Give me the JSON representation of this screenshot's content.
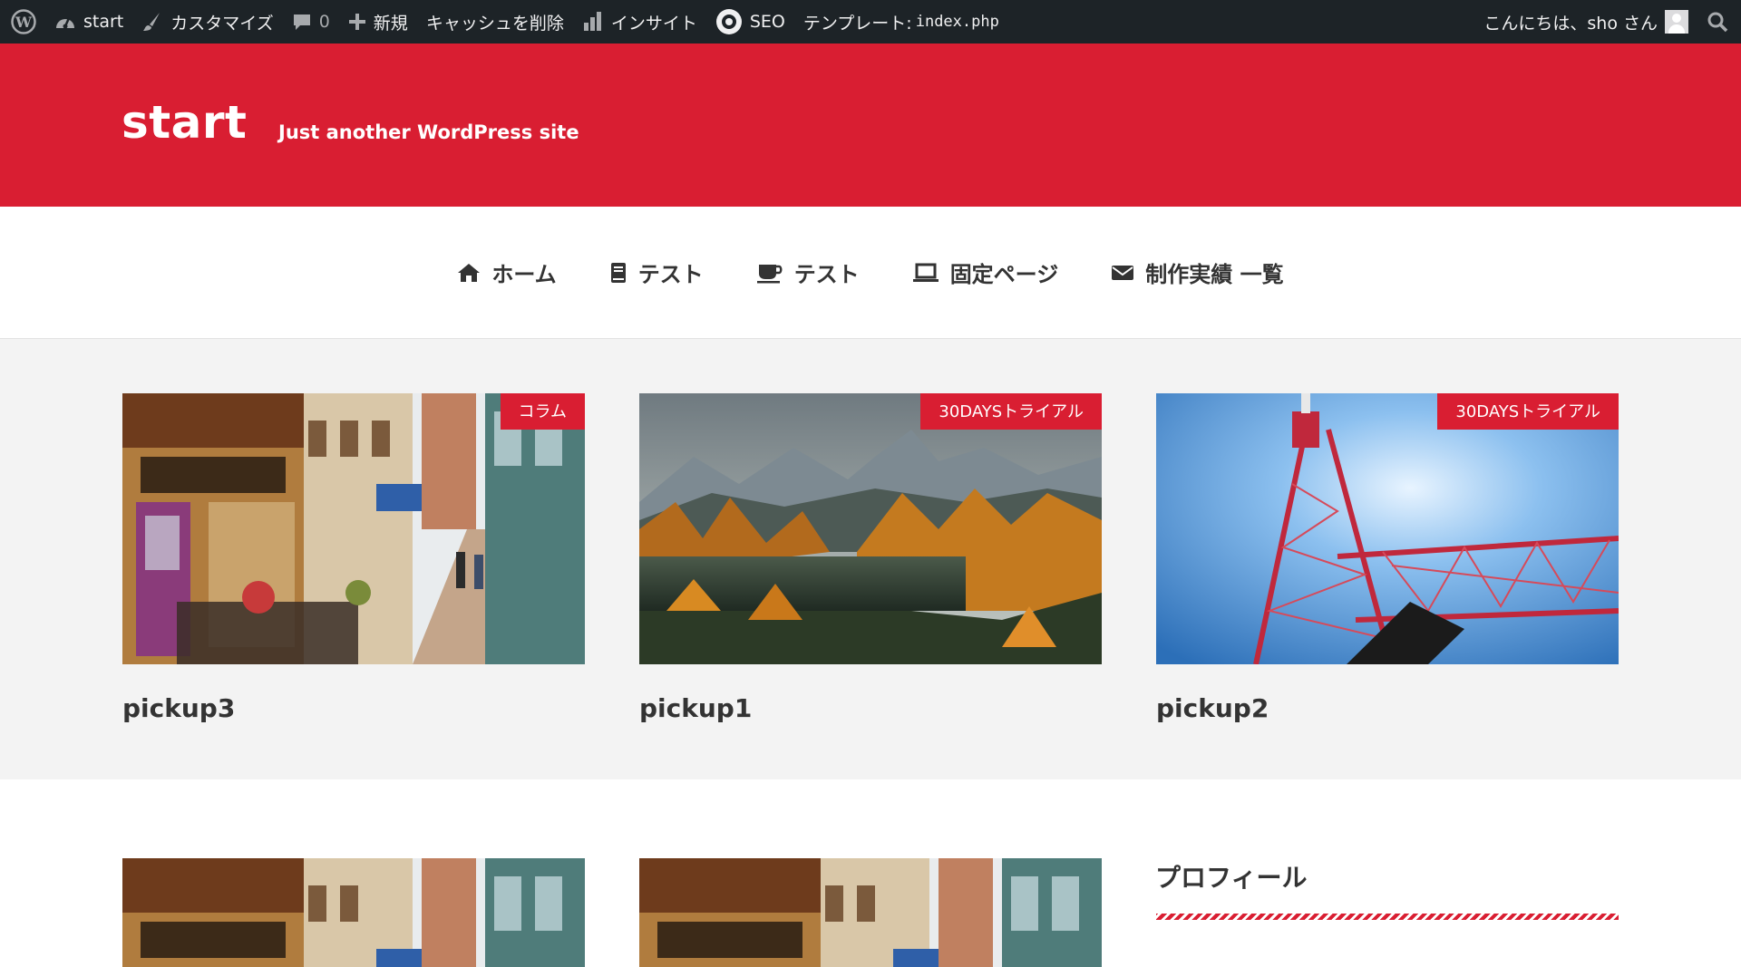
{
  "admin_bar": {
    "site": "start",
    "customize": "カスタマイズ",
    "comments_count": "0",
    "new": "新規",
    "clear_cache": "キャッシュを削除",
    "insights": "インサイト",
    "seo": "SEO",
    "template_label": "テンプレート:",
    "template_file": "index.php",
    "greeting": "こんにちは、sho さん"
  },
  "header": {
    "title": "start",
    "description": "Just another WordPress site",
    "color": "#d91e32"
  },
  "nav": [
    {
      "label": "ホーム",
      "icon": "home-icon"
    },
    {
      "label": "テスト",
      "icon": "book-icon"
    },
    {
      "label": "テスト",
      "icon": "coffee-icon"
    },
    {
      "label": "固定ページ",
      "icon": "laptop-icon"
    },
    {
      "label": "制作実績 一覧",
      "icon": "envelope-icon"
    }
  ],
  "pickup": [
    {
      "title": "pickup3",
      "category": "コラム",
      "image": "street-cafe-photo"
    },
    {
      "title": "pickup1",
      "category": "30DAYSトライアル",
      "image": "autumn-lake-mountains-photo"
    },
    {
      "title": "pickup2",
      "category": "30DAYSトライアル",
      "image": "tokyo-tower-photo"
    }
  ],
  "sidebar": {
    "widget_title": "プロフィール"
  }
}
